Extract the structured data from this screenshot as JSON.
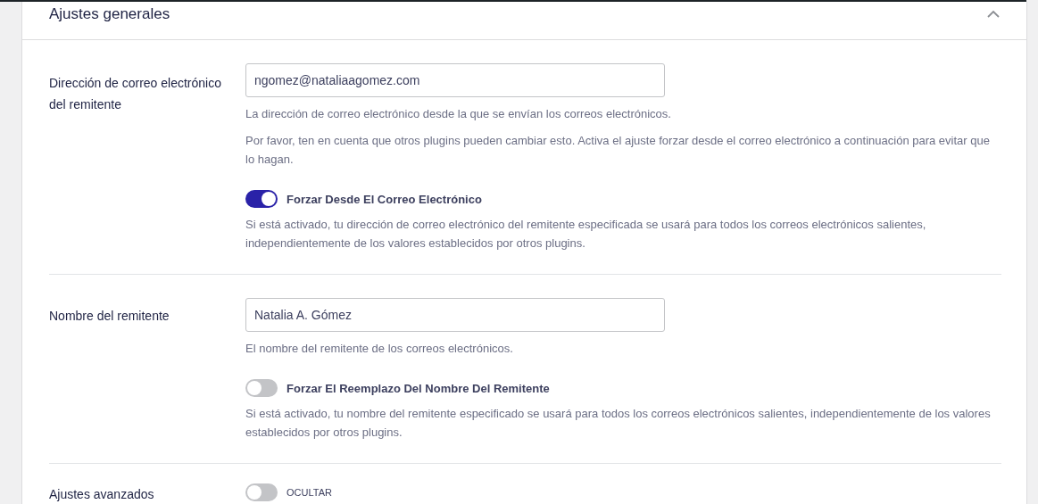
{
  "panel": {
    "title": "Ajustes generales",
    "expanded": true
  },
  "settings": [
    {
      "label": "Dirección de correo electrónico del remitente",
      "field": {
        "value": "ngomez@nataliaagomez.com"
      },
      "descriptions": [
        "La dirección de correo electrónico desde la que se envían los correos electrónicos.",
        "Por favor, ten en cuenta que otros plugins pueden cambiar esto. Activa el ajuste forzar desde el correo electrónico a continuación para evitar que lo hagan."
      ],
      "toggle": {
        "label": "Forzar Desde El Correo Electrónico",
        "on": true,
        "description": "Si está activado, tu dirección de correo electrónico del remitente especificada se usará para todos los correos electrónicos salientes, independientemente de los valores establecidos por otros plugins."
      }
    },
    {
      "label": "Nombre del remitente",
      "field": {
        "value": "Natalia A. Gómez"
      },
      "descriptions": [
        "El nombre del remitente de los correos electrónicos."
      ],
      "toggle": {
        "label": "Forzar El Reemplazo Del Nombre Del Remitente",
        "on": false,
        "description": "Si está activado, tu nombre del remitente especificado se usará para todos los correos electrónicos salientes, independientemente de los valores establecidos por otros plugins."
      }
    },
    {
      "label": "Ajustes avanzados",
      "toggle": {
        "label": "OCULTAR",
        "on": false
      }
    }
  ]
}
